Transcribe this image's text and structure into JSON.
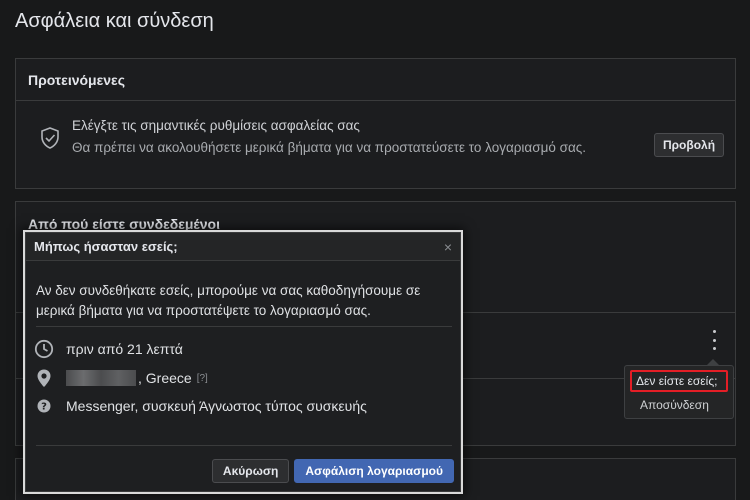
{
  "page": {
    "title": "Ασφάλεια και σύνδεση"
  },
  "recommended": {
    "header": "Προτεινόμενες",
    "title": "Ελέγξτε τις σημαντικές ρυθμίσεις ασφαλείας σας",
    "description": "Θα πρέπει να ακολουθήσετε μερικά βήματα για να προστατεύσετε το λογαριασμό σας.",
    "view_button": "Προβολή"
  },
  "sessions": {
    "header": "Από πού είστε συνδεδεμένοι"
  },
  "session_menu": {
    "not_you": "Δεν είστε εσείς;",
    "logout": "Αποσύνδεση"
  },
  "modal": {
    "title": "Μήπως ήσασταν εσείς;",
    "close": "×",
    "text": "Αν δεν συνδεθήκατε εσείς, μπορούμε να σας καθοδηγήσουμε σε μερικά βήματα για να προστατέψετε το λογαριασμό σας.",
    "time": "πριν από 21 λεπτά",
    "location": ", Greece",
    "location_help": "[?]",
    "device": "Messenger, συσκευή Άγνωστος τύπος συσκευής",
    "cancel_button": "Ακύρωση",
    "secure_button": "Ασφάλιση λογαριασμού"
  },
  "colors": {
    "accent": "#4267b2",
    "highlight": "#e41e26",
    "background": "#18191a"
  }
}
